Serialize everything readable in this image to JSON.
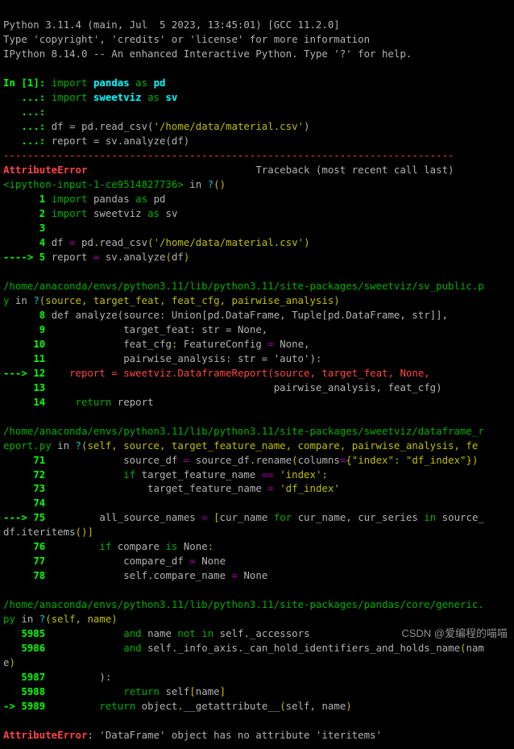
{
  "header": {
    "line1": "Python 3.11.4 (main, Jul  5 2023, 13:45:01) [GCC 11.2.0]",
    "line2": "Type 'copyright', 'credits' or 'license' for more information",
    "line3": "IPython 8.14.0 -- An enhanced Interactive Python. Type '?' for help."
  },
  "prompt": {
    "in_num": "1",
    "kw_import": "import",
    "kw_as": "as",
    "pkg_pandas": "pandas",
    "alias_pd": "pd",
    "pkg_sweetviz": "sweetviz",
    "alias_sv": "sv",
    "assign_df": "df = pd.read_csv(",
    "csv_path": "'/home/data/material.csv'",
    "assign_report": "report = sv.analyze(df)"
  },
  "dashes": "---------------------------------------------------------------------------",
  "err": {
    "name": "AttributeError",
    "tb_label": "Traceback (most recent call last)",
    "ipy_loc": "<ipython-input-1-ce9514827736>",
    "in_q": " in ",
    "q_open": "?",
    "ln1": "1",
    "ln2": "2",
    "ln3": "3",
    "ln4": "4",
    "ln5": "5",
    "l1_a": "import",
    "l1_b": "pandas",
    "l1_c": "as",
    "l1_d": "pd",
    "l2_b": "sweetviz",
    "l2_d": "sv",
    "l4": "df ",
    "l4op": "=",
    "l4b": " pd",
    "l4dot": ".",
    "l4c": "read_csv",
    "l4paren": "(",
    "l4s": "'/home/data/material.csv'",
    "l4close": ")",
    "arrow": "----> ",
    "l5": "report ",
    "l5b": " sv",
    "l5c": "analyze",
    "l5d": "df"
  },
  "f1": {
    "path": "/home/anaconda/envs/python3.11/lib/python3.11/site-packages/sweetviz/sv_public.p",
    "line2": "y",
    "args": "(source, target_feat, feat_cfg, pairwise_analysis)",
    "n8": "8",
    "l8": "def analyze(source: Union[pd.DataFrame, Tuple[pd.DataFrame, str]],",
    "n9": "9",
    "l9": "            target_feat: str = None,",
    "n10": "10",
    "l10": "            feat_cfg: FeatureConfig = None,",
    "n11": "11",
    "l11": "            pairwise_analysis: str = 'auto'):",
    "n12": "12",
    "arrow": "---> ",
    "l12a": "    report ",
    "l12b": " sweetviz",
    "l12c": "DataframeReport",
    "l12d": "source",
    "l12e": " target_feat",
    "l12f": " None",
    "n13": "13",
    "l13": "                                     pairwise_analysis, feat_cfg)",
    "n14": "14",
    "l14a": "    ",
    "l14b": "return",
    "l14c": " report"
  },
  "f2": {
    "path": "/home/anaconda/envs/python3.11/lib/python3.11/site-packages/sweetviz/dataframe_r",
    "line2": "eport.py",
    "args": "(self, source, target_feature_name, compare, pairwise_analysis, fe",
    "n71": "71",
    "l71a": "            source_df ",
    "l71b": " source_df",
    "l71c": "rename",
    "l71d": "columns",
    "l71e": "{\"index\": \"df_index\"}",
    "n72": "72",
    "l72a": "            ",
    "l72if": "if",
    "l72b": " target_feature_name ",
    "l72eq": "==",
    "l72c": " 'index'",
    "l72colon": ":",
    "n73": "73",
    "l73a": "                target_feature_name ",
    "l73b": " 'df_index'",
    "n74": "74",
    "n75": "75",
    "arrow": "---> ",
    "l75a": "        all_source_names ",
    "l75b": "[",
    "l75c": "cur_name ",
    "l75for": "for",
    "l75d": " cur_name",
    "l75e": " cur_series ",
    "l75in": "in",
    "l75f": " source_",
    "l75g": "df",
    "l75h": "iteritems",
    "l75i": "()]",
    "n76": "76",
    "l76a": "        ",
    "l76if": "if",
    "l76b": " compare ",
    "l76is": "is",
    "l76c": " None",
    "l76colon": ":",
    "n77": "77",
    "l77a": "            compare_df ",
    "l77b": " None",
    "n78": "78",
    "l78a": "            self",
    "l78b": "compare_name ",
    "l78c": " None"
  },
  "f3": {
    "path": "/home/anaconda/envs/python3.11/lib/python3.11/site-packages/pandas/core/generic.",
    "line2": "py",
    "args": "(self, name)",
    "n5985": "5985",
    "l85a": "            ",
    "l85and": "and",
    "l85b": " name ",
    "l85not": "not",
    "l85c": " ",
    "l85in": "in",
    "l85d": " self",
    "l85e": "_accessors",
    "n5986": "5986",
    "l86a": "            ",
    "l86and": "and",
    "l86b": " self",
    "l86c": "_info_axis",
    "l86d": "_can_hold_identifiers_and_holds_name",
    "l86e": "nam",
    "l86f": "e",
    "n5987": "5987",
    "l87": "        ):",
    "n5988": "5988",
    "l88a": "            ",
    "l88ret": "return",
    "l88b": " self",
    "l88c": "name",
    "arrow": "-> ",
    "n5989": "5989",
    "l89a": "        ",
    "l89ret": "return",
    "l89b": " object",
    "l89c": "__getattribute__",
    "l89d": "self",
    "l89e": " name"
  },
  "final": {
    "err": "AttributeError",
    "msg": ": 'DataFrame' object has no attribute 'iteritems'"
  },
  "watermark": "CSDN @爱编程的喵喵"
}
